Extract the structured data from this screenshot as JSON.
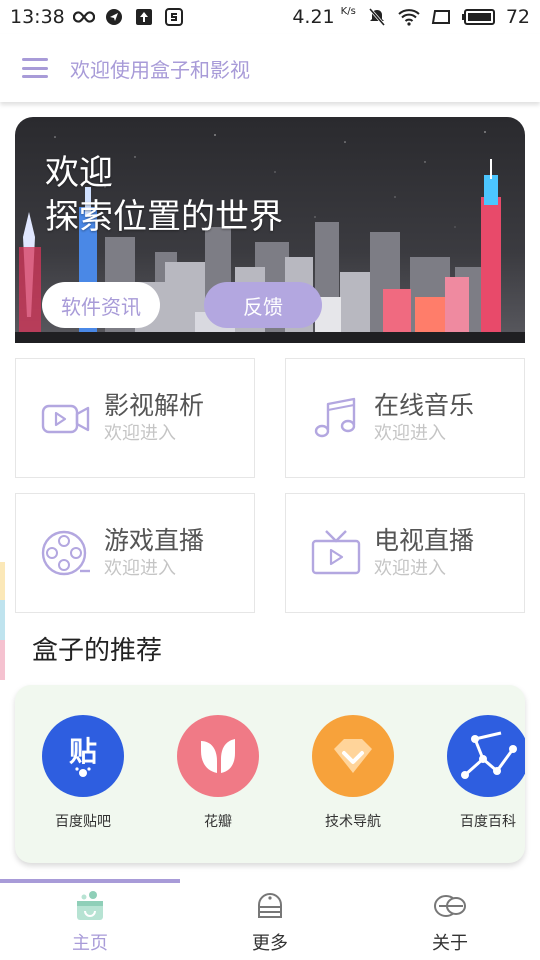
{
  "status_bar": {
    "time": "13:38",
    "speed": "4.21",
    "speed_unit": "K/s",
    "battery": "72"
  },
  "top_bar": {
    "title": "欢迎使用盒子和影视"
  },
  "banner": {
    "line1": "欢迎",
    "line2": "探索位置的世界",
    "news_button": "软件资讯",
    "feedback_button": "反馈"
  },
  "cards": [
    {
      "title": "影视解析",
      "subtitle": "欢迎进入",
      "icon": "video-camera-icon"
    },
    {
      "title": "在线音乐",
      "subtitle": "欢迎进入",
      "icon": "music-note-icon"
    },
    {
      "title": "游戏直播",
      "subtitle": "欢迎进入",
      "icon": "film-reel-icon"
    },
    {
      "title": "电视直播",
      "subtitle": "欢迎进入",
      "icon": "tv-icon"
    }
  ],
  "section_title": "盒子的推荐",
  "recommend": [
    {
      "label": "百度贴吧",
      "glyph": "贴",
      "color": "#2e5ee0",
      "icon": "tieba-icon"
    },
    {
      "label": "花瓣",
      "color": "#f07a86",
      "icon": "huaban-icon"
    },
    {
      "label": "技术导航",
      "color": "#f7a23b",
      "icon": "diamond-icon"
    },
    {
      "label": "百度百科",
      "color": "#2e5ee0",
      "icon": "baike-icon"
    }
  ],
  "bottom_nav": [
    {
      "label": "主页",
      "icon": "home-box-icon",
      "active": true
    },
    {
      "label": "更多",
      "icon": "more-icon",
      "active": false
    },
    {
      "label": "关于",
      "icon": "about-icon",
      "active": false
    }
  ],
  "colors": {
    "accent": "#a89bd8",
    "accent_fill": "#b3a7e0",
    "recommend_bg": "#f1f8ef"
  }
}
